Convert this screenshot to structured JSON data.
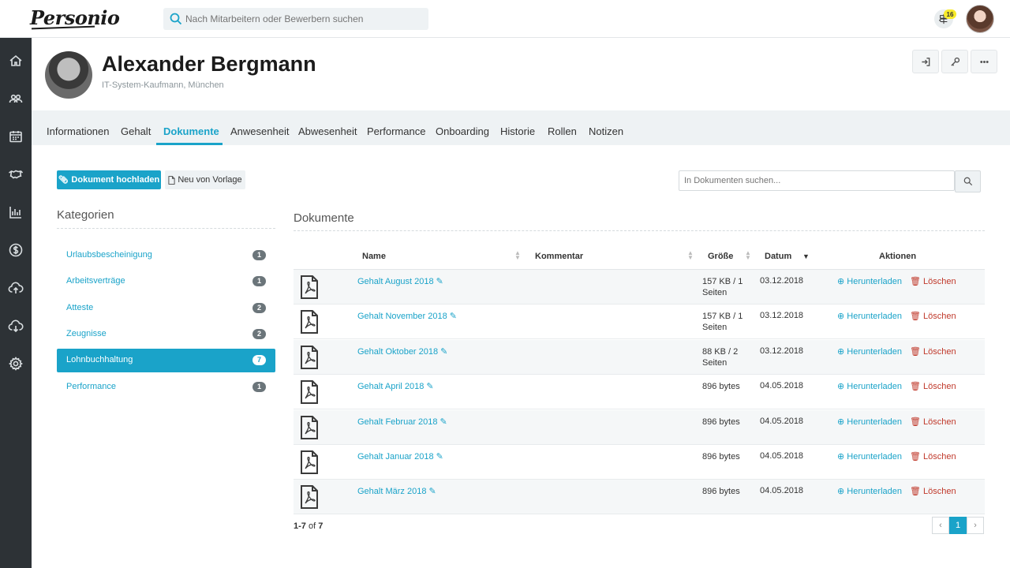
{
  "app": {
    "logo": "Personio",
    "search_placeholder": "Nach Mitarbeitern oder Bewerbern suchen",
    "notification_count": "16"
  },
  "sidebar": {
    "items": [
      "home-icon",
      "people-icon",
      "calendar-icon",
      "handshake-icon",
      "chart-icon",
      "dollar-icon",
      "upload-cloud-icon",
      "download-cloud-icon",
      "gear-icon"
    ]
  },
  "profile": {
    "name": "Alexander Bergmann",
    "subtitle": "IT-System-Kaufmann, München"
  },
  "tabs": [
    "Informationen",
    "Gehalt",
    "Dokumente",
    "Anwesenheit",
    "Abwesenheit",
    "Performance",
    "Onboarding",
    "Historie",
    "Rollen",
    "Notizen"
  ],
  "active_tab": "Dokumente",
  "actions": {
    "upload_label": "Dokument hochladen",
    "new_label": "Neu von Vorlage",
    "doc_search_placeholder": "In Dokumenten suchen..."
  },
  "categories": {
    "title": "Kategorien",
    "items": [
      {
        "label": "Urlaubsbescheinigung",
        "count": "1"
      },
      {
        "label": "Arbeitsverträge",
        "count": "1"
      },
      {
        "label": "Atteste",
        "count": "2"
      },
      {
        "label": "Zeugnisse",
        "count": "2"
      },
      {
        "label": "Lohnbuchhaltung",
        "count": "7"
      },
      {
        "label": "Performance",
        "count": "1"
      }
    ],
    "active": "Lohnbuchhaltung"
  },
  "documents": {
    "title": "Dokumente",
    "columns": {
      "name": "Name",
      "comment": "Kommentar",
      "size": "Größe",
      "date": "Datum",
      "actions": "Aktionen"
    },
    "download_label": "Herunterladen",
    "delete_label": "Löschen",
    "rows": [
      {
        "name": "Gehalt August 2018",
        "size": "157 KB / 1 Seiten",
        "date": "03.12.2018"
      },
      {
        "name": "Gehalt November 2018",
        "size": "157 KB / 1 Seiten",
        "date": "03.12.2018"
      },
      {
        "name": "Gehalt Oktober 2018",
        "size": "88 KB / 2 Seiten",
        "date": "03.12.2018"
      },
      {
        "name": "Gehalt April 2018",
        "size": "896 bytes",
        "date": "04.05.2018"
      },
      {
        "name": "Gehalt Februar 2018",
        "size": "896 bytes",
        "date": "04.05.2018"
      },
      {
        "name": "Gehalt Januar 2018",
        "size": "896 bytes",
        "date": "04.05.2018"
      },
      {
        "name": "Gehalt März 2018",
        "size": "896 bytes",
        "date": "04.05.2018"
      }
    ]
  },
  "pagination": {
    "range": "1-7",
    "of_label": "of",
    "total": "7",
    "current_page": "1"
  },
  "colors": {
    "accent": "#1aa3c9",
    "sidebar_bg": "#2d3236",
    "delete": "#c0392b",
    "badge": "#f7ea2a"
  }
}
